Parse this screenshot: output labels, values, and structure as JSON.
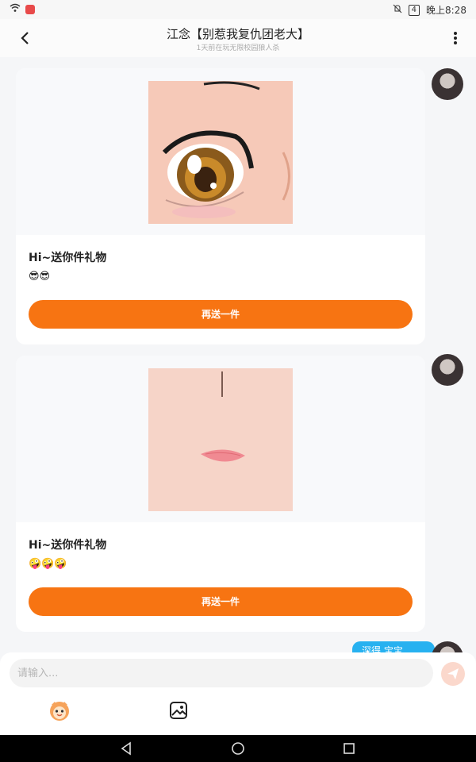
{
  "status_bar": {
    "time": "晚上8:28",
    "battery": "4",
    "icons": [
      "wifi-icon",
      "app-notification-icon",
      "mute-icon",
      "battery-icon"
    ]
  },
  "header": {
    "title": "江念【别惹我复仇团老大】",
    "subtitle": "1天前在玩无限校园狼人杀",
    "icons": [
      "back-arrow-icon",
      "more-vertical-icon"
    ]
  },
  "messages": [
    {
      "image": "anime-eye-gift-image",
      "text": "Hi~送你件礼物",
      "emojis": "😎😎",
      "button": "再送一件"
    },
    {
      "image": "anime-mouth-gift-image",
      "text": "Hi~送你件礼物",
      "emojis": "🤪🤪🤪",
      "button": "再送一件"
    }
  ],
  "partial_bubble_text": "深得 宝宝",
  "input": {
    "placeholder": "请输入..."
  },
  "toolbar_icons": [
    "emoji-face-icon",
    "image-icon",
    "send-icon"
  ],
  "nav_icons": [
    "back-triangle-icon",
    "home-circle-icon",
    "recents-square-icon"
  ],
  "colors": {
    "accent_orange": "#f77412",
    "bubble_blue": "#27b1f0",
    "background": "#f5f6f8"
  }
}
